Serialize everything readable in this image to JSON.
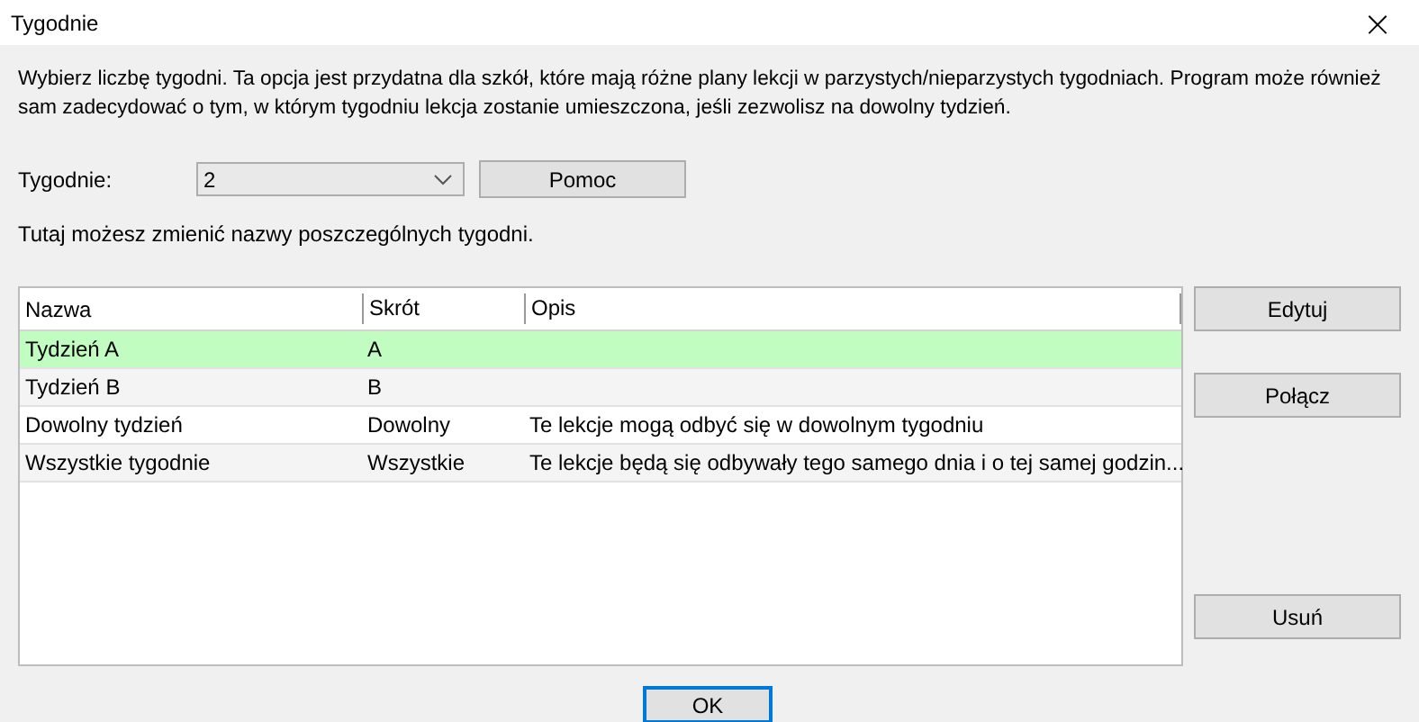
{
  "window": {
    "title": "Tygodnie",
    "close": "×"
  },
  "description": "Wybierz liczbę tygodni. Ta opcja jest przydatna dla szkół, które mają różne plany lekcji w parzystych/nieparzystych tygodniach. Program może również sam zadecydować o tym, w którym tygodniu lekcja zostanie umieszczona, jeśli zezwolisz na dowolny tydzień.",
  "weeks_field": {
    "label": "Tygodnie:",
    "value": "2"
  },
  "help_button": "Pomoc",
  "hint": "Tutaj możesz zmienić nazwy poszczególnych tygodni.",
  "table": {
    "columns": [
      "Nazwa",
      "Skrót",
      "Opis"
    ],
    "rows": [
      {
        "cells": [
          "Tydzień A",
          "A",
          ""
        ],
        "selected": true
      },
      {
        "cells": [
          "Tydzień B",
          "B",
          ""
        ],
        "selected": false
      },
      {
        "cells": [
          "Dowolny tydzień",
          "Dowolny",
          "Te lekcje mogą odbyć się w dowolnym tygodniu"
        ],
        "selected": false
      },
      {
        "cells": [
          "Wszystkie tygodnie",
          "Wszystkie",
          "Te lekcje będą się odbywały tego samego dnia i o tej samej godzin..."
        ],
        "selected": false
      }
    ]
  },
  "side_buttons": [
    "Edytuj",
    "Połącz",
    "Usuń"
  ],
  "ok_button": {
    "label": "OK",
    "focused": true
  }
}
